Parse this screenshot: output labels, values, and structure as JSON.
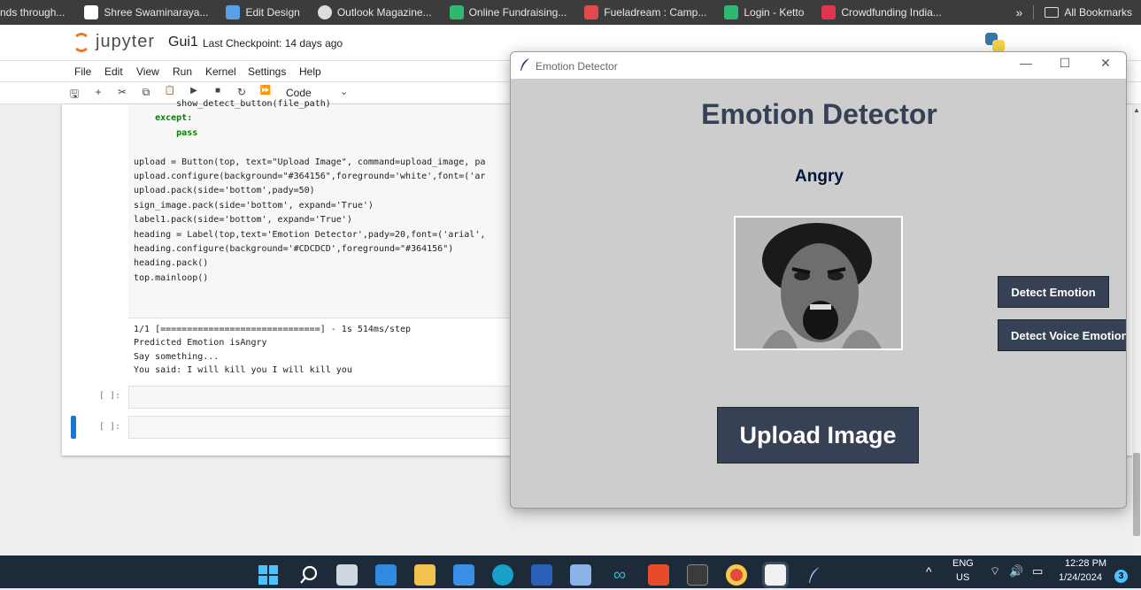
{
  "bookmarks": {
    "items": [
      {
        "label": "nds through...",
        "color": "#3c3c3c"
      },
      {
        "label": "Shree Swaminaraya...",
        "color": "#ffffff"
      },
      {
        "label": "Edit Design",
        "color": "#5aa0e6"
      },
      {
        "label": "Outlook Magazine...",
        "color": "#dddddd"
      },
      {
        "label": "Online Fundraising...",
        "color": "#2eb872"
      },
      {
        "label": "Fueladream : Camp...",
        "color": "#e24a4a"
      },
      {
        "label": "Login - Ketto",
        "color": "#2eb872"
      },
      {
        "label": "Crowdfunding India...",
        "color": "#e0334f"
      }
    ],
    "overflow": "»",
    "all_bookmarks": "All Bookmarks"
  },
  "jupyter": {
    "logo_text": "jupyter",
    "notebook_name": "Gui1",
    "checkpoint": "Last Checkpoint: 14 days ago",
    "menu": [
      "File",
      "Edit",
      "View",
      "Run",
      "Kernel",
      "Settings",
      "Help"
    ],
    "toolbar": {
      "save": "🖫",
      "add": "+",
      "cut": "✂",
      "copy": "⧉",
      "paste": "📋",
      "run": "▶",
      "stop": "■",
      "restart": "↻",
      "run_all": "⏩",
      "cell_type": "Code",
      "chevron": "⌄"
    },
    "code_lines": [
      "        show_detect_button(file_path)",
      "    except:",
      "        pass",
      "",
      "upload = Button(top, text=\"Upload Image\", command=upload_image, pa",
      "upload.configure(background=\"#364156\",foreground='white',font=('ar",
      "upload.pack(side='bottom',pady=50)",
      "sign_image.pack(side='bottom', expand='True')",
      "label1.pack(side='bottom', expand='True')",
      "heading = Label(top,text='Emotion Detector',pady=20,font=('arial',",
      "heading.configure(background='#CDCDCD',foreground=\"#364156\")",
      "heading.pack()",
      "top.mainloop()"
    ],
    "output_lines": [
      "1/1 [==============================] - 1s 514ms/step",
      "Predicted Emotion isAngry",
      "Say something...",
      "You said: I will kill you I will kill you"
    ],
    "empty_prompt": "[ ]:"
  },
  "tk_window": {
    "title": "Emotion Detector",
    "heading": "Emotion Detector",
    "label": "Angry",
    "photo_name": "angry-face-photo",
    "detect_button": "Detect Emotion",
    "voice_button": "Detect Voice Emotion",
    "upload_button": "Upload Image",
    "min_glyph": "—",
    "max_glyph": "☐",
    "close_glyph": "✕",
    "colors": {
      "background": "#CDCDCD",
      "button": "#364156",
      "heading": "#364156"
    }
  },
  "taskbar": {
    "language": "ENG",
    "region": "US",
    "time": "12:28 PM",
    "date": "1/24/2024",
    "notifications": "3",
    "chevron": "^"
  }
}
